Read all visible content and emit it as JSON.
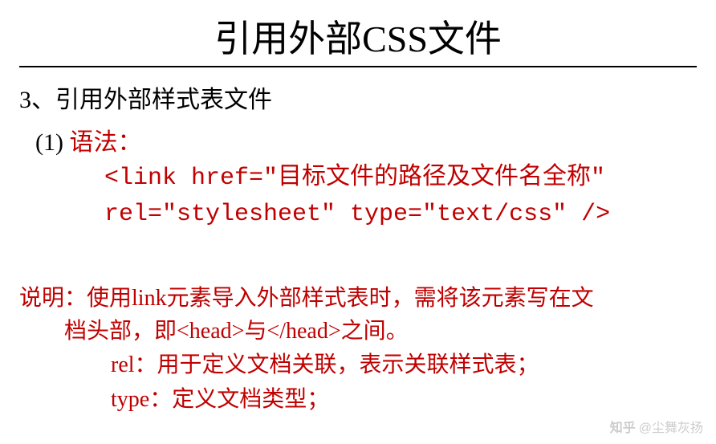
{
  "title": "引用外部CSS文件",
  "heading": "3、引用外部样式表文件",
  "subheading_num": "(1) ",
  "subheading_text": "语法：",
  "code_line1": "<link href=\"目标文件的路径及文件名全称\"",
  "code_line2": "rel=\"stylesheet\" type=\"text/css\"  />",
  "desc_label": "说明：",
  "desc_line1_rest": "使用link元素导入外部样式表时，需将该元素写在文",
  "desc_line2": "档头部，即<head>与</head>之间。",
  "desc_line3": "rel：用于定义文档关联，表示关联样式表；",
  "desc_line4": "type：定义文档类型；",
  "watermark_brand": "知乎",
  "watermark_user": "@尘舞灰扬"
}
